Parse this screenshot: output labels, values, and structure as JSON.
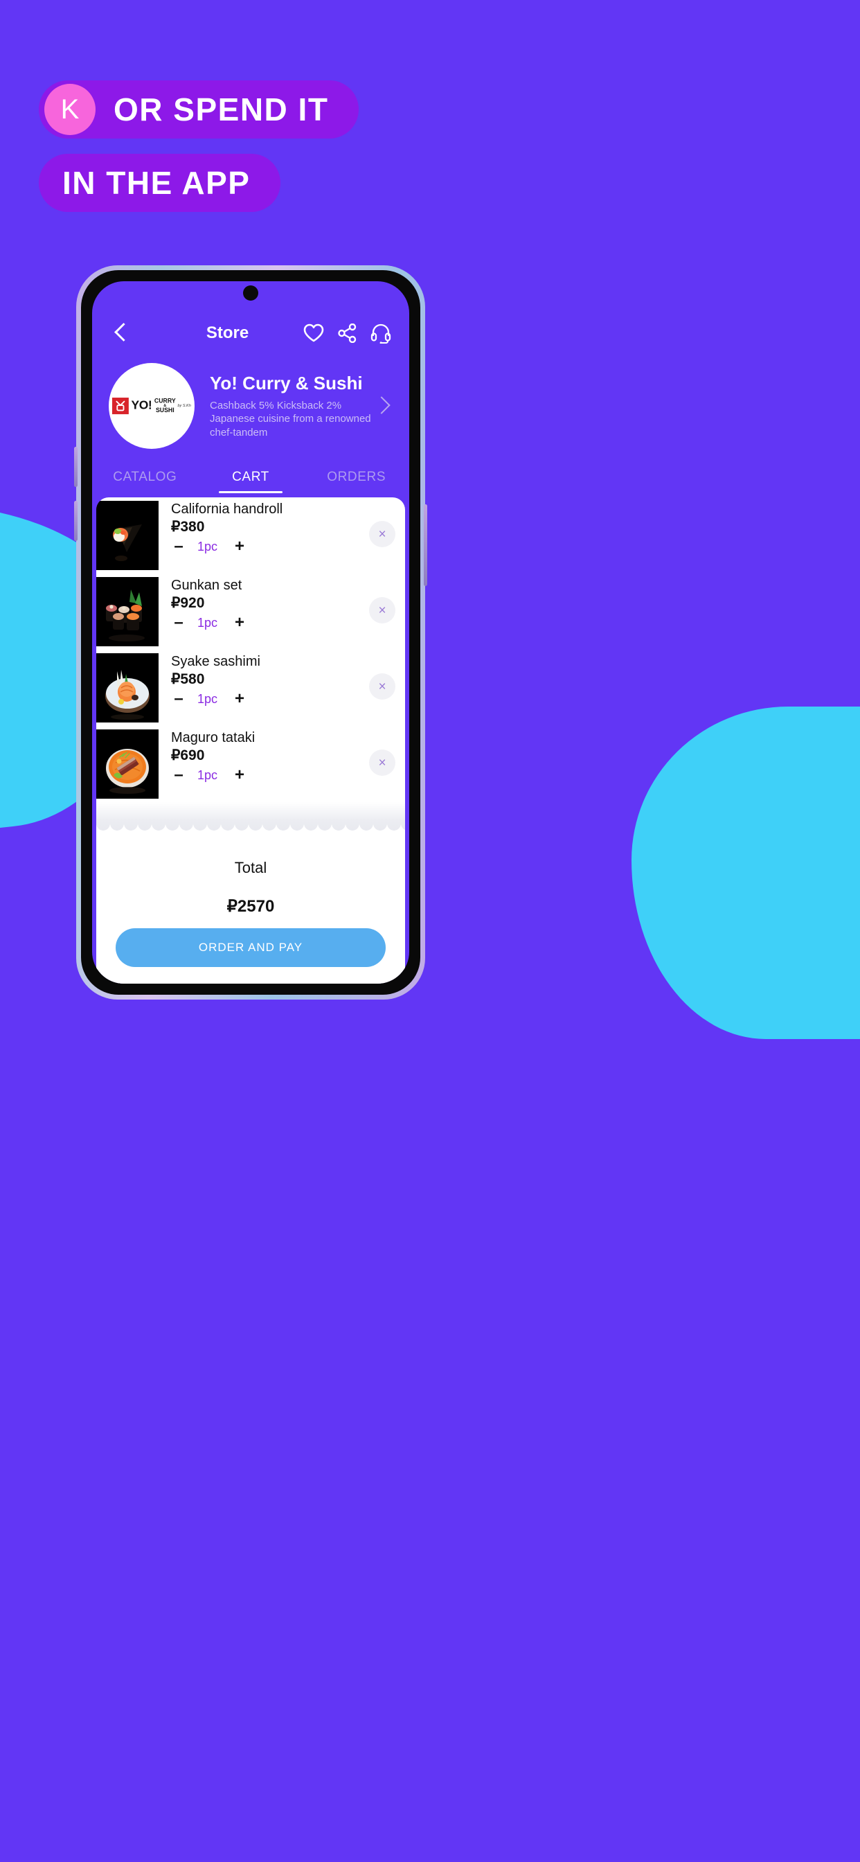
{
  "background": {
    "color": "#6236F5",
    "accent_cyan": "#3FD0F8"
  },
  "headline": {
    "logo_letter": "K",
    "line1": "OR SPEND IT",
    "line2": "IN THE APP",
    "pill_color": "#8D19E8",
    "logo_color": "#F765DC"
  },
  "app": {
    "header": {
      "back_label": "‹",
      "title": "Store",
      "icons": [
        {
          "name": "heart-icon",
          "label": "Favorite"
        },
        {
          "name": "share-icon",
          "label": "Share"
        },
        {
          "name": "headset-icon",
          "label": "Support"
        }
      ]
    },
    "store": {
      "name": "Yo! Curry & Sushi",
      "cashback": "Cashback 5% Kicksback 2%",
      "description": "Japanese cuisine from a renowned chef-tandem",
      "logo": {
        "brand": "YO!",
        "word1": "CURRY",
        "amp": "&",
        "word2": "SUSHI",
        "signature": "by S.Kh"
      },
      "chevron": "›"
    },
    "tabs": [
      {
        "label": "CATALOG",
        "active": false
      },
      {
        "label": "CART",
        "active": true
      },
      {
        "label": "ORDERS",
        "active": false
      }
    ],
    "cart": {
      "items": [
        {
          "name": "California handroll",
          "price": "₽380",
          "qty": "1pc",
          "minus": "–",
          "plus": "+",
          "remove": "×"
        },
        {
          "name": "Gunkan set",
          "price": "₽920",
          "qty": "1pc",
          "minus": "–",
          "plus": "+",
          "remove": "×"
        },
        {
          "name": "Syake sashimi",
          "price": "₽580",
          "qty": "1pc",
          "minus": "–",
          "plus": "+",
          "remove": "×"
        },
        {
          "name": "Maguro tataki",
          "price": "₽690",
          "qty": "1pc",
          "minus": "–",
          "plus": "+",
          "remove": "×"
        }
      ],
      "total_label": "Total",
      "total_value": "₽2570",
      "pay_button": "ORDER AND PAY",
      "qty_color": "#8A2BE2",
      "pay_button_color": "#57AEEF"
    }
  }
}
